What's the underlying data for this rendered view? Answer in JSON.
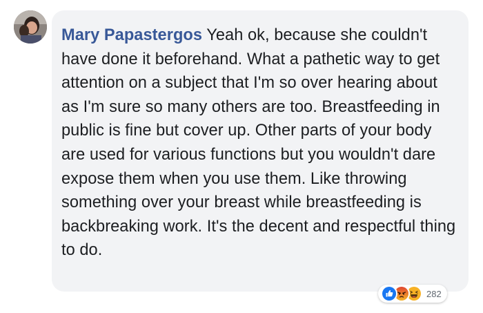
{
  "comment": {
    "author": "Mary Papastergos",
    "text": " Yeah ok, because she couldn't have done it beforehand. What a pathetic way to get attention on a subject that I'm so over hearing about as I'm sure so many others are too. Breastfeeding in public is fine but cover up. Other parts of your body are used for various functions but you wouldn't dare expose them when you use them. Like throwing something over your breast while breastfeeding is backbreaking work. It's the decent and respectful thing to do."
  },
  "reactions": {
    "icons": [
      "like-icon",
      "angry-icon",
      "haha-icon"
    ],
    "count": "282"
  },
  "colors": {
    "author": "#385898",
    "bubble": "#f2f3f5",
    "text": "#1c1e21",
    "like": "#1877f2",
    "angry": "#e9710f",
    "haha": "#f7b125"
  }
}
